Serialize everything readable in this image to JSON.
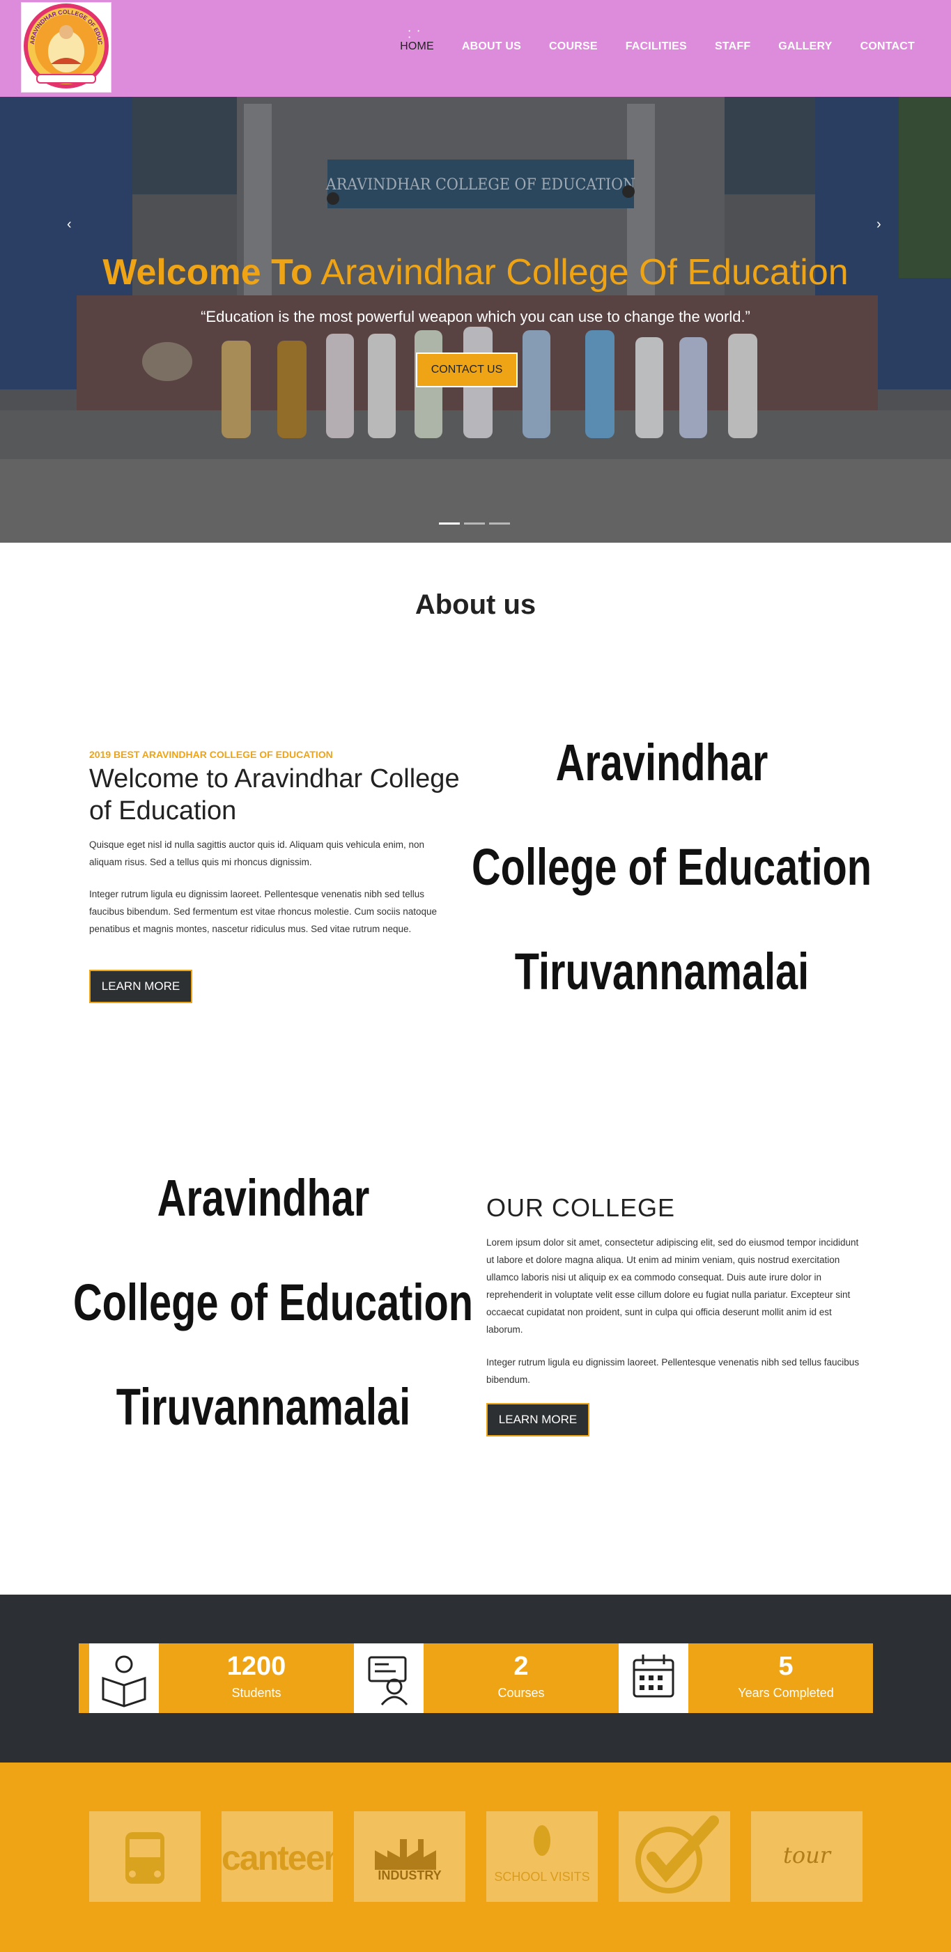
{
  "header": {
    "logo_text": "ARAVINDHAR COLLEGE OF EDUCATION",
    "nav": [
      "HOME",
      "ABOUT US",
      "COURSE",
      "FACILITIES",
      "STAFF",
      "GALLERY",
      "CONTACT"
    ],
    "active_index": 0
  },
  "hero": {
    "building_sign": "ARAVINDHAR COLLEGE OF EDUCATION",
    "title_bold": "Welcome To",
    "title_rest": "Aravindhar College Of Education",
    "quote": "“Education is the most powerful weapon which you can use to change the world.”",
    "button": "CONTACT US",
    "slides_count": 3,
    "active_slide": 0
  },
  "about": {
    "heading": "About us",
    "eyebrow": "2019 BEST ARAVINDHAR COLLEGE OF EDUCATION",
    "title": "Welcome to Aravindhar College of Education",
    "para1": "Quisque eget nisl id nulla sagittis auctor quis id. Aliquam quis vehicula enim, non aliquam risus. Sed a tellus quis mi rhoncus dignissim.",
    "para2": "Integer rutrum ligula eu dignissim laoreet. Pellentesque venenatis nibh sed tellus faucibus bibendum. Sed fermentum est vitae rhoncus molestie. Cum sociis natoque penatibus et magnis montes, nascetur ridiculus mus. Sed vitae rutrum neque.",
    "button": "LEARN MORE",
    "image_lines": [
      "Aravindhar",
      "College of Education",
      "Tiruvannamalai"
    ]
  },
  "college": {
    "title": "OUR COLLEGE",
    "para1": "Lorem ipsum dolor sit amet, consectetur adipiscing elit, sed do eiusmod tempor incididunt ut labore et dolore magna aliqua. Ut enim ad minim veniam, quis nostrud exercitation ullamco laboris nisi ut aliquip ex ea commodo consequat. Duis aute irure dolor in reprehenderit in voluptate velit esse cillum dolore eu fugiat nulla pariatur. Excepteur sint occaecat cupidatat non proident, sunt in culpa qui officia deserunt mollit anim id est laborum.",
    "para2": "Integer rutrum ligula eu dignissim laoreet. Pellentesque venenatis nibh sed tellus faucibus bibendum.",
    "button": "LEARN MORE",
    "image_lines": [
      "Aravindhar",
      "College of Education",
      "Tiruvannamalai"
    ]
  },
  "counters": [
    {
      "icon": "book-reader-icon",
      "number": "1200",
      "label": "Students"
    },
    {
      "icon": "teacher-screen-icon",
      "number": "2",
      "label": "Courses"
    },
    {
      "icon": "calendar-icon",
      "number": "5",
      "label": "Years Completed"
    }
  ],
  "facilities": [
    {
      "icon": "bus-icon",
      "label": ""
    },
    {
      "icon": "canteen-icon",
      "label": "canteen"
    },
    {
      "icon": "industry-icon",
      "label": "INDUSTRY"
    },
    {
      "icon": "school-visits-icon",
      "label": "SCHOOL VISITS"
    },
    {
      "icon": "certified-check-icon",
      "label": ""
    },
    {
      "icon": "tour-icon",
      "label": "tour"
    }
  ],
  "colors": {
    "header_bg": "#dd8cdb",
    "accent": "#efa415",
    "dark": "#2c2f33"
  }
}
